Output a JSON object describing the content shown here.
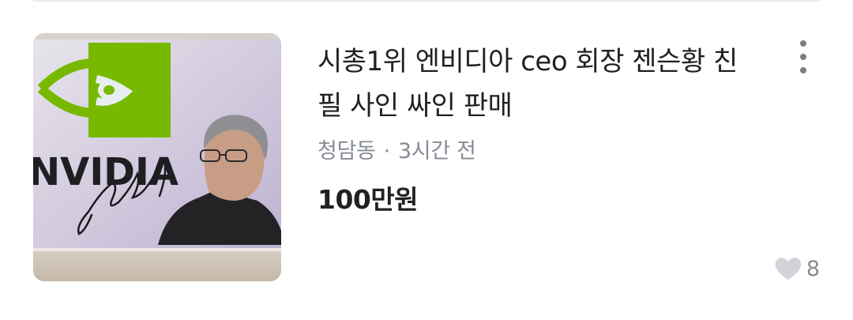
{
  "listing": {
    "title": "시총1위 엔비디아 ceo 회장 젠슨황 친필 사인 싸인 판매",
    "location": "청담동",
    "separator": "·",
    "time_ago": "3시간 전",
    "price": "100만원",
    "like_count": "8",
    "thumbnail": {
      "logo_text": "NVIDIA",
      "brand_color": "#76b900"
    }
  },
  "icons": {
    "more": "more-vertical-icon",
    "like": "heart-icon"
  }
}
